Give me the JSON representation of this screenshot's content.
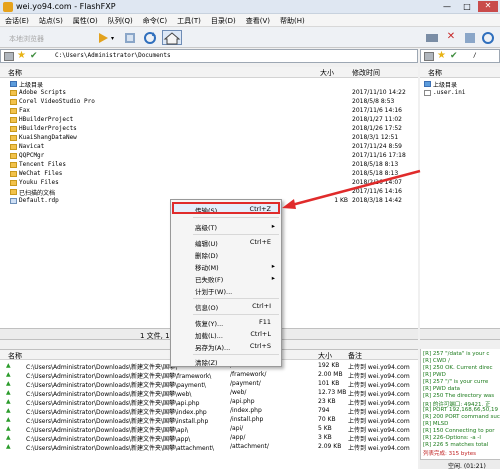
{
  "window": {
    "title": "wei.yo94.com - FlashFXP"
  },
  "menu": [
    "会话(E)",
    "站点(S)",
    "属性(O)",
    "队列(Q)",
    "命令(C)",
    "工具(T)",
    "目录(D)",
    "查看(V)",
    "帮助(H)"
  ],
  "toolbar": {
    "connect_label": "本地浏览器"
  },
  "local": {
    "path": "C:\\Users\\Administrator\\Documents",
    "columns": {
      "name": "名称",
      "size": "大小",
      "modified": "修改时间"
    },
    "up_label": "上级目录",
    "files": [
      {
        "name": "Adobe Scripts",
        "size": "",
        "date": "2017/11/10 14:22"
      },
      {
        "name": "Corel VideoStudio Pro",
        "size": "",
        "date": "2018/5/8 8:53"
      },
      {
        "name": "Fax",
        "size": "",
        "date": "2017/11/6 14:16"
      },
      {
        "name": "HBuilderProject",
        "size": "",
        "date": "2018/1/27 11:02"
      },
      {
        "name": "HBuilderProjects",
        "size": "",
        "date": "2018/1/26 17:52"
      },
      {
        "name": "KuaiShangDataNew",
        "size": "",
        "date": "2018/3/1 12:51"
      },
      {
        "name": "Navicat",
        "size": "",
        "date": "2017/11/24 8:59"
      },
      {
        "name": "QQPCMgr",
        "size": "",
        "date": "2017/11/16 17:18"
      },
      {
        "name": "Tencent Files",
        "size": "",
        "date": "2018/5/18 8:13"
      },
      {
        "name": "WeChat Files",
        "size": "",
        "date": "2018/5/18 8:13"
      },
      {
        "name": "Youku Files",
        "size": "",
        "date": "2018/2/26 14:07"
      },
      {
        "name": "已扫描的文档",
        "size": "",
        "date": "2017/11/6 14:16"
      },
      {
        "name": "Default.rdp",
        "size": "1 KB",
        "date": "2018/3/18 14:42"
      }
    ],
    "status": "1 文件, 12 ..."
  },
  "remote": {
    "path": "/",
    "columns": {
      "name": "名称"
    },
    "up_label": "上级目录",
    "files": [
      {
        "name": ".user.ini"
      }
    ]
  },
  "context_menu": [
    {
      "label": "传输(S)",
      "key": "Ctrl+Z",
      "arrow": ""
    },
    {
      "label": "高级(T)",
      "key": "",
      "arrow": "▸"
    },
    {
      "label": "编辑(U)",
      "key": "Ctrl+E",
      "arrow": ""
    },
    {
      "label": "删除(D)",
      "key": "",
      "arrow": ""
    },
    {
      "label": "移动(M)",
      "key": "",
      "arrow": "▸"
    },
    {
      "label": "已失败(F)",
      "key": "",
      "arrow": "▸"
    },
    {
      "label": "计划于(W)...",
      "key": "",
      "arrow": ""
    },
    {
      "label": "信息(O)",
      "key": "Ctrl+I",
      "arrow": ""
    },
    {
      "label": "恢复(Y)...",
      "key": "F11",
      "arrow": ""
    },
    {
      "label": "加载(L)...",
      "key": "Ctrl+L",
      "arrow": ""
    },
    {
      "label": "另存为(A)...",
      "key": "Ctrl+S",
      "arrow": ""
    },
    {
      "label": "清除(Z)",
      "key": "",
      "arrow": ""
    }
  ],
  "queue": {
    "columns": {
      "name": "名称",
      "target": "目标",
      "size": "大小",
      "note": "备注"
    },
    "rows": [
      {
        "src": "C:\\Users\\Administrator\\Downloads\\新建文件夹\\国攀\\",
        "target": "/",
        "size": "192 KB",
        "note": "上传到 wei.yo94.com"
      },
      {
        "src": "C:\\Users\\Administrator\\Downloads\\新建文件夹\\国攀\\framework\\",
        "target": "/framework/",
        "size": "2.00 MB",
        "note": "上传到 wei.yo94.com"
      },
      {
        "src": "C:\\Users\\Administrator\\Downloads\\新建文件夹\\国攀\\payment\\",
        "target": "/payment/",
        "size": "101 KB",
        "note": "上传到 wei.yo94.com"
      },
      {
        "src": "C:\\Users\\Administrator\\Downloads\\新建文件夹\\国攀\\web\\",
        "target": "/web/",
        "size": "12.73 MB",
        "note": "上传到 wei.yo94.com"
      },
      {
        "src": "C:\\Users\\Administrator\\Downloads\\新建文件夹\\国攀\\api.php",
        "target": "/api.php",
        "size": "23 KB",
        "note": "上传到 wei.yo94.com"
      },
      {
        "src": "C:\\Users\\Administrator\\Downloads\\新建文件夹\\国攀\\index.php",
        "target": "/index.php",
        "size": "794",
        "note": "上传到 wei.yo94.com"
      },
      {
        "src": "C:\\Users\\Administrator\\Downloads\\新建文件夹\\国攀\\install.php",
        "target": "/install.php",
        "size": "70 KB",
        "note": "上传到 wei.yo94.com"
      },
      {
        "src": "C:\\Users\\Administrator\\Downloads\\新建文件夹\\国攀\\api\\",
        "target": "/api/",
        "size": "5 KB",
        "note": "上传到 wei.yo94.com"
      },
      {
        "src": "C:\\Users\\Administrator\\Downloads\\新建文件夹\\国攀\\app\\",
        "target": "/app/",
        "size": "3 KB",
        "note": "上传到 wei.yo94.com"
      },
      {
        "src": "C:\\Users\\Administrator\\Downloads\\新建文件夹\\国攀\\attachment\\",
        "target": "/attachment/",
        "size": "2.09 KB",
        "note": "上传到 wei.yo94.com"
      }
    ]
  },
  "log": [
    {
      "text": "[R] 257 \"/data\" is your c",
      "color": "#1a7a1a"
    },
    {
      "text": "[R] CWD /",
      "color": "#1a7a1a"
    },
    {
      "text": "[R] 250 OK. Current direc",
      "color": "#1a7a1a"
    },
    {
      "text": "[R] PWD",
      "color": "#1a7a1a"
    },
    {
      "text": "[R] 257 \"/\" is your curre",
      "color": "#1a7a1a"
    },
    {
      "text": "[R] PWD data",
      "color": "#1a7a1a"
    },
    {
      "text": "[R] 250 The directory was",
      "color": "#1a7a1a"
    },
    {
      "text": "[R] 的许可端口: 49421. 正",
      "color": "#1a7a1a"
    },
    {
      "text": "[R] PORT 192,168,66,50,19",
      "color": "#1a7a1a"
    },
    {
      "text": "[R] 200 PORT command succ",
      "color": "#1a7a1a"
    },
    {
      "text": "[R] MLSD",
      "color": "#1a7a1a"
    },
    {
      "text": "[R] 150 Connecting to por",
      "color": "#1a7a1a"
    },
    {
      "text": "[R] 226-Options: -a -l",
      "color": "#1a7a1a"
    },
    {
      "text": "[R] 226 5 matches total",
      "color": "#1a7a1a"
    },
    {
      "text": "列表完成: 315 bytes",
      "color": "#c02020"
    }
  ],
  "bottom_status": "空闲. (01:21)"
}
